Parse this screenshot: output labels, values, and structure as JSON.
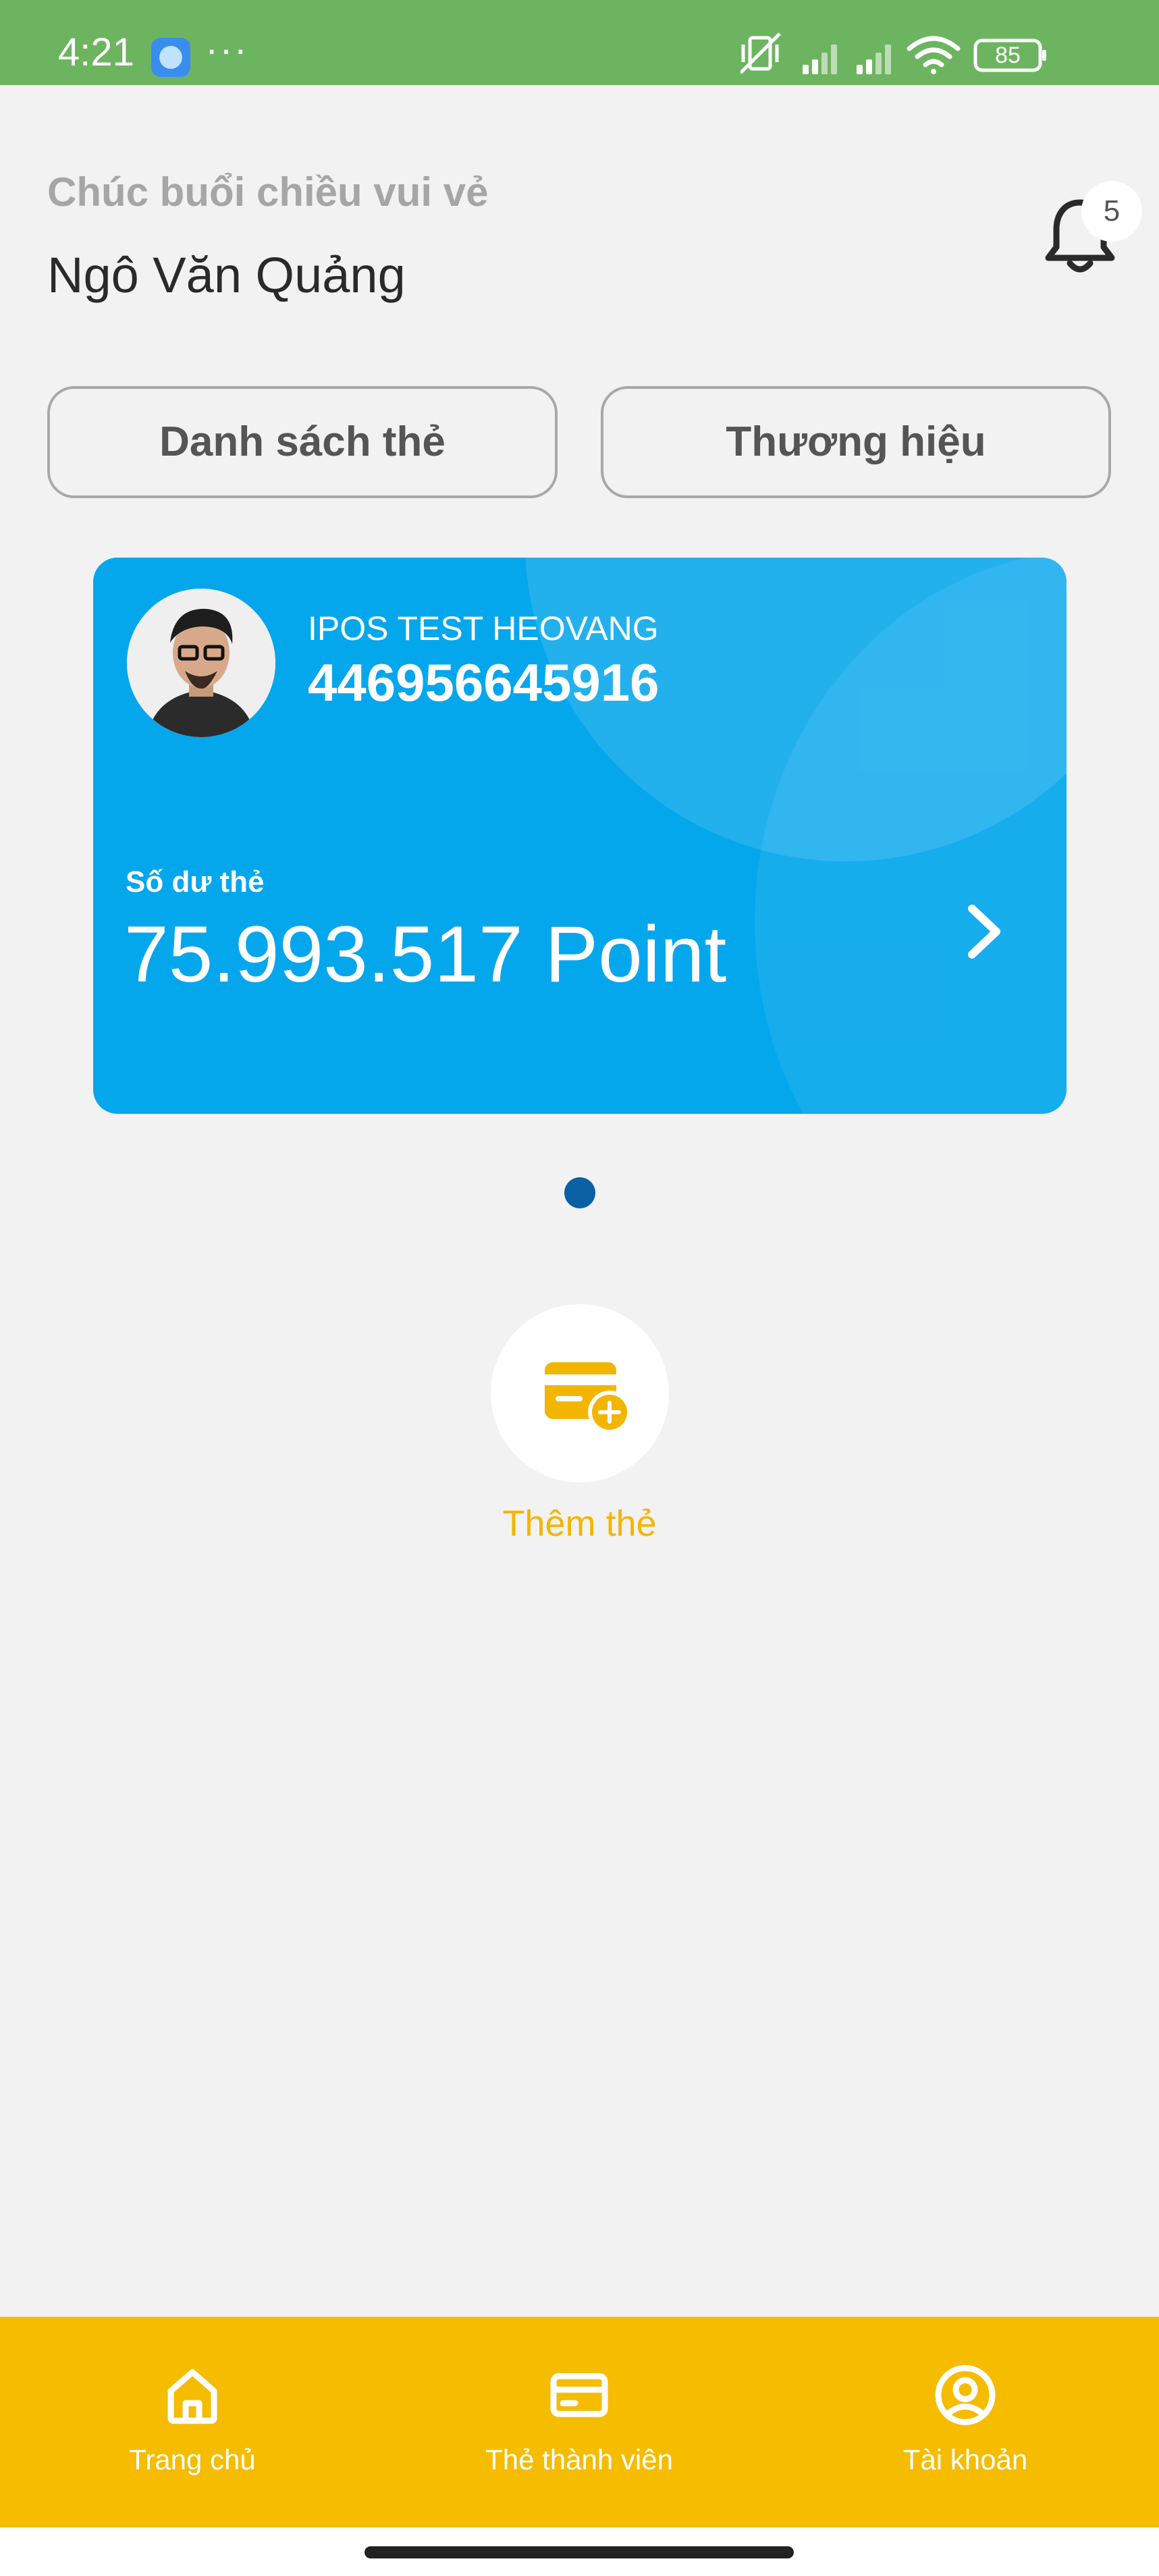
{
  "status_bar": {
    "time": "4:21",
    "dots": "···",
    "battery": "85",
    "icons": [
      "app-icon",
      "mute-icon",
      "signal-icon",
      "signal-icon",
      "wifi-icon",
      "battery-icon"
    ]
  },
  "header": {
    "greeting": "Chúc buổi chiều vui vẻ",
    "user_name": "Ngô Văn Quảng",
    "notification_count": "5"
  },
  "tabs": [
    {
      "label": "Danh sách thẻ"
    },
    {
      "label": "Thương hiệu"
    }
  ],
  "card": {
    "brand": "IPOS TEST HEOVANG",
    "number": "446956645916",
    "balance_label": "Số dư thẻ",
    "balance_value": "75.993.517 Point",
    "color": "#05a7ec"
  },
  "pager": {
    "total": 1,
    "active": 0
  },
  "add_card": {
    "label": "Thêm thẻ",
    "color": "#f2b600"
  },
  "bottom_nav": {
    "color": "#f5bc00",
    "items": [
      {
        "label": "Trang chủ",
        "icon": "home-icon"
      },
      {
        "label": "Thẻ thành viên",
        "icon": "card-icon"
      },
      {
        "label": "Tài khoản",
        "icon": "account-icon"
      }
    ]
  }
}
